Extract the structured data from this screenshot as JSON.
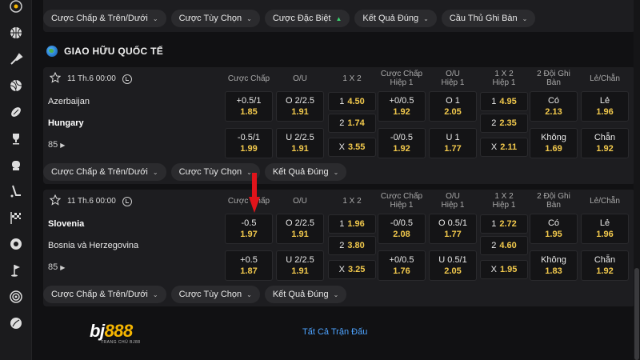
{
  "colors": {
    "odds": "#f2c94c",
    "link": "#4da3ff",
    "brand_yellow": "#f5b500",
    "arrow": "#e0141b"
  },
  "sidebar": {
    "icons": [
      "crown-icon",
      "basketball-icon",
      "badminton-icon",
      "volleyball-icon",
      "football-icon",
      "trophy-icon",
      "boxing-icon",
      "hockey-icon",
      "racing-flag-icon",
      "esports-icon",
      "golf-icon",
      "target-icon",
      "rugby-icon"
    ]
  },
  "top_pills": [
    {
      "label": "Cược Chấp & Trên/Dưới"
    },
    {
      "label": "Cược Tùy Chọn"
    },
    {
      "label": "Cược Đặc Biệt"
    },
    {
      "label": "Kết Quả Đúng"
    },
    {
      "label": "Cầu Thủ Ghi Bàn"
    }
  ],
  "section": {
    "title": "GIAO HỮU QUỐC TẾ"
  },
  "columns": [
    "Cược Chấp",
    "O/U",
    "1 X 2",
    "Cược Chấp\nHiệp 1",
    "O/U\nHiệp 1",
    "1 X 2\nHiệp 1",
    "2 Đội Ghi Bàn",
    "Lẻ/Chẵn"
  ],
  "matches": [
    {
      "time": "11 Th.6 00:00",
      "home": "Azerbaijan",
      "away": "Hungary",
      "bold_team": "away",
      "more": "85",
      "row1": [
        {
          "l": "+0.5/1",
          "v": "1.85"
        },
        {
          "l": "O 2/2.5",
          "v": "1.91"
        },
        {
          "l": "1",
          "v": "4.50"
        },
        {
          "l": "+0/0.5",
          "v": "1.92"
        },
        {
          "l": "O 1",
          "v": "2.05"
        },
        {
          "l": "1",
          "v": "4.95"
        },
        {
          "l": "Có",
          "v": "2.13"
        },
        {
          "l": "Lẻ",
          "v": "1.96"
        }
      ],
      "mid": [
        {
          "l": "2",
          "v": "1.74"
        },
        {
          "l": "2",
          "v": "2.35"
        }
      ],
      "row2": [
        {
          "l": "-0.5/1",
          "v": "1.99"
        },
        {
          "l": "U 2/2.5",
          "v": "1.91"
        },
        {
          "l": "X",
          "v": "3.55"
        },
        {
          "l": "-0/0.5",
          "v": "1.92"
        },
        {
          "l": "U 1",
          "v": "1.77"
        },
        {
          "l": "X",
          "v": "2.11"
        },
        {
          "l": "Không",
          "v": "1.69"
        },
        {
          "l": "Chẵn",
          "v": "1.92"
        }
      ],
      "pills": [
        {
          "label": "Cược Chấp & Trên/Dưới"
        },
        {
          "label": "Cược Tùy Chọn"
        },
        {
          "label": "Kết Quả Đúng"
        }
      ]
    },
    {
      "time": "11 Th.6 00:00",
      "home": "Slovenia",
      "away": "Bosnia và Herzegovina",
      "bold_team": "home",
      "more": "85",
      "row1": [
        {
          "l": "-0.5",
          "v": "1.97"
        },
        {
          "l": "O 2/2.5",
          "v": "1.91"
        },
        {
          "l": "1",
          "v": "1.96"
        },
        {
          "l": "-0/0.5",
          "v": "2.08"
        },
        {
          "l": "O 0.5/1",
          "v": "1.77"
        },
        {
          "l": "1",
          "v": "2.72"
        },
        {
          "l": "Có",
          "v": "1.95"
        },
        {
          "l": "Lẻ",
          "v": "1.96"
        }
      ],
      "mid": [
        {
          "l": "2",
          "v": "3.80"
        },
        {
          "l": "2",
          "v": "4.60"
        }
      ],
      "row2": [
        {
          "l": "+0.5",
          "v": "1.87"
        },
        {
          "l": "U 2/2.5",
          "v": "1.91"
        },
        {
          "l": "X",
          "v": "3.25"
        },
        {
          "l": "+0/0.5",
          "v": "1.76"
        },
        {
          "l": "U 0.5/1",
          "v": "2.05"
        },
        {
          "l": "X",
          "v": "1.95"
        },
        {
          "l": "Không",
          "v": "1.83"
        },
        {
          "l": "Chẵn",
          "v": "1.92"
        }
      ],
      "pills": [
        {
          "label": "Cược Chấp & Trên/Dưới"
        },
        {
          "label": "Cược Tùy Chọn"
        },
        {
          "label": "Kết Quả Đúng"
        }
      ]
    }
  ],
  "footer": {
    "logo_bj": "bj",
    "logo_888": "888",
    "logo_sub": "TRANG CHỦ BJ88",
    "link": "Tất Cả Trận Đấu"
  }
}
